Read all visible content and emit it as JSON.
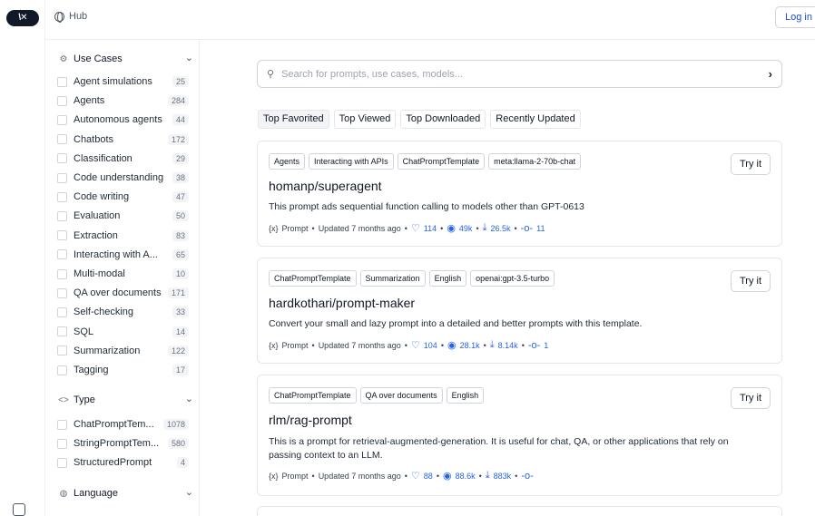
{
  "header": {
    "hub_label": "Hub",
    "login_label": "Log in"
  },
  "logo_text": "\\✕",
  "sidebar": {
    "use_cases": {
      "title": "Use Cases",
      "items": [
        {
          "label": "Agent simulations",
          "count": "25"
        },
        {
          "label": "Agents",
          "count": "284"
        },
        {
          "label": "Autonomous agents",
          "count": "44"
        },
        {
          "label": "Chatbots",
          "count": "172"
        },
        {
          "label": "Classification",
          "count": "29"
        },
        {
          "label": "Code understanding",
          "count": "38"
        },
        {
          "label": "Code writing",
          "count": "47"
        },
        {
          "label": "Evaluation",
          "count": "50"
        },
        {
          "label": "Extraction",
          "count": "83"
        },
        {
          "label": "Interacting with A...",
          "count": "65"
        },
        {
          "label": "Multi-modal",
          "count": "10"
        },
        {
          "label": "QA over documents",
          "count": "171"
        },
        {
          "label": "Self-checking",
          "count": "33"
        },
        {
          "label": "SQL",
          "count": "14"
        },
        {
          "label": "Summarization",
          "count": "122"
        },
        {
          "label": "Tagging",
          "count": "17"
        }
      ]
    },
    "type": {
      "title": "Type",
      "items": [
        {
          "label": "ChatPromptTem...",
          "count": "1078"
        },
        {
          "label": "StringPromptTem...",
          "count": "580"
        },
        {
          "label": "StructuredPrompt",
          "count": "4"
        }
      ]
    },
    "language": {
      "title": "Language"
    }
  },
  "search": {
    "placeholder": "Search for prompts, use cases, models..."
  },
  "tabs": [
    {
      "label": "Top Favorited",
      "active": true
    },
    {
      "label": "Top Viewed",
      "active": false
    },
    {
      "label": "Top Downloaded",
      "active": false
    },
    {
      "label": "Recently Updated",
      "active": false
    }
  ],
  "cards": [
    {
      "tags": [
        "Agents",
        "Interacting with APIs",
        "ChatPromptTemplate",
        "meta:llama-2-70b-chat"
      ],
      "try_label": "Try it",
      "title": "homanp/superagent",
      "description": "This prompt ads sequential function calling to models other than GPT-0613",
      "kind": "Prompt",
      "updated": "Updated 7 months ago",
      "likes": "114",
      "views": "49k",
      "downloads": "26.5k",
      "commits": "11"
    },
    {
      "tags": [
        "ChatPromptTemplate",
        "Summarization",
        "English",
        "openai:gpt-3.5-turbo"
      ],
      "try_label": "Try it",
      "title": "hardkothari/prompt-maker",
      "description": "Convert your small and lazy prompt into a detailed and better prompts with this template.",
      "kind": "Prompt",
      "updated": "Updated 7 months ago",
      "likes": "104",
      "views": "28.1k",
      "downloads": "8.14k",
      "commits": "1"
    },
    {
      "tags": [
        "ChatPromptTemplate",
        "QA over documents",
        "English"
      ],
      "try_label": "Try it",
      "title": "rlm/rag-prompt",
      "description": "This is a prompt for retrieval-augmented-generation. It is useful for chat, QA, or other applications that rely on passing context to an LLM.",
      "kind": "Prompt",
      "updated": "Updated 7 months ago",
      "likes": "88",
      "views": "88.6k",
      "downloads": "883k",
      "commits": ""
    }
  ],
  "colors": {
    "accent": "#2563eb",
    "border": "#e5e7eb",
    "text": "#111827"
  }
}
